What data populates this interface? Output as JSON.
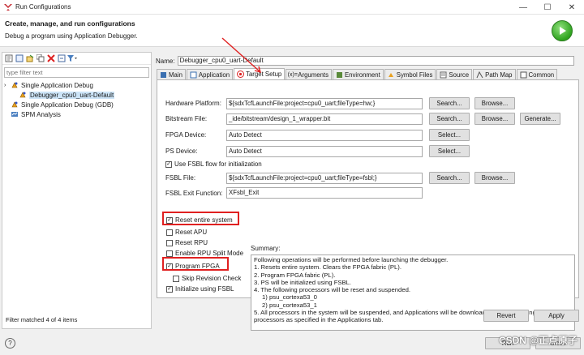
{
  "window": {
    "title": "Run Configurations",
    "minimize": "—",
    "maximize": "☐",
    "close": "✕"
  },
  "header": {
    "title": "Create, manage, and run configurations",
    "subtitle": "Debug a program using Application Debugger."
  },
  "left": {
    "toolbar_icons": [
      "new-config-icon",
      "new-prototype-icon",
      "export-icon",
      "duplicate-icon",
      "delete-icon",
      "collapse-all-icon",
      "filter-icon"
    ],
    "filter_placeholder": "type filter text",
    "tree": [
      {
        "label": "Single Application Debug",
        "level": 0,
        "expanded": true,
        "icon": "debug-config-icon"
      },
      {
        "label": "Debugger_cpu0_uart-Default",
        "level": 1,
        "selected": true,
        "icon": "debug-config-icon"
      },
      {
        "label": "Single Application Debug (GDB)",
        "level": 0,
        "icon": "debug-config-icon"
      },
      {
        "label": "SPM Analysis",
        "level": 0,
        "icon": "spm-icon"
      }
    ],
    "filter_status": "Filter matched 4 of 4 items"
  },
  "name_label": "Name:",
  "name_value": "Debugger_cpu0_uart-Default",
  "tabs": [
    {
      "label": "Main",
      "icon": "main-tab-icon"
    },
    {
      "label": "Application",
      "icon": "application-tab-icon"
    },
    {
      "label": "Target Setup",
      "icon": "target-tab-icon",
      "active": true
    },
    {
      "label": "Arguments",
      "icon": "arguments-tab-icon"
    },
    {
      "label": "Environment",
      "icon": "environment-tab-icon"
    },
    {
      "label": "Symbol Files",
      "icon": "symbol-files-tab-icon"
    },
    {
      "label": "Source",
      "icon": "source-tab-icon"
    },
    {
      "label": "Path Map",
      "icon": "path-map-tab-icon"
    },
    {
      "label": "Common",
      "icon": "common-tab-icon"
    }
  ],
  "fields": {
    "hw_platform_label": "Hardware Platform:",
    "hw_platform_value": "${sdxTcfLaunchFile:project=cpu0_uart;fileType=hw;}",
    "bitstream_label": "Bitstream File:",
    "bitstream_value": "_ide/bitstream/design_1_wrapper.bit",
    "fpga_label": "FPGA Device:",
    "fpga_value": "Auto Detect",
    "ps_label": "PS Device:",
    "ps_value": "Auto Detect",
    "use_fsbl_label": "Use FSBL flow for initialization",
    "fsbl_label": "FSBL File:",
    "fsbl_value": "${sdxTcfLaunchFile:project=cpu0_uart;fileType=fsbl;}",
    "fsbl_exit_label": "FSBL Exit Function:",
    "fsbl_exit_value": "XFsbl_Exit"
  },
  "buttons": {
    "search": "Search...",
    "browse": "Browse...",
    "generate": "Generate...",
    "select": "Select...",
    "revert": "Revert",
    "apply": "Apply",
    "run": "Run",
    "close": "Close"
  },
  "checkboxes": [
    {
      "label": "Reset entire system",
      "checked": true
    },
    {
      "label": "Reset APU",
      "checked": false
    },
    {
      "label": "Reset RPU",
      "checked": false
    },
    {
      "label": "Enable RPU Split Mode",
      "checked": false
    },
    {
      "label": "Program FPGA",
      "checked": true
    },
    {
      "label": "Skip Revision Check",
      "checked": false
    },
    {
      "label": "Initialize using FSBL",
      "checked": true
    }
  ],
  "summary": {
    "title": "Summary:",
    "lines": [
      "Following operations will be performed before launching the debugger.",
      "1. Resets entire system. Clears the FPGA fabric (PL).",
      "2. Program FPGA fabric (PL).",
      "3. PS will be initialized using FSBL.",
      "4. The following processors will be reset and suspended.",
      "    1) psu_cortexa53_0",
      "    2) psu_cortexa53_1",
      "5. All processors in the system will be suspended, and Applications will be downloaded to the following",
      "processors as specified in the Applications tab."
    ]
  },
  "watermark": "CSDN @正点原子",
  "colors": {
    "highlight": "#e02020",
    "selected": "#cce4f7",
    "run_green": "#2fa31f"
  }
}
